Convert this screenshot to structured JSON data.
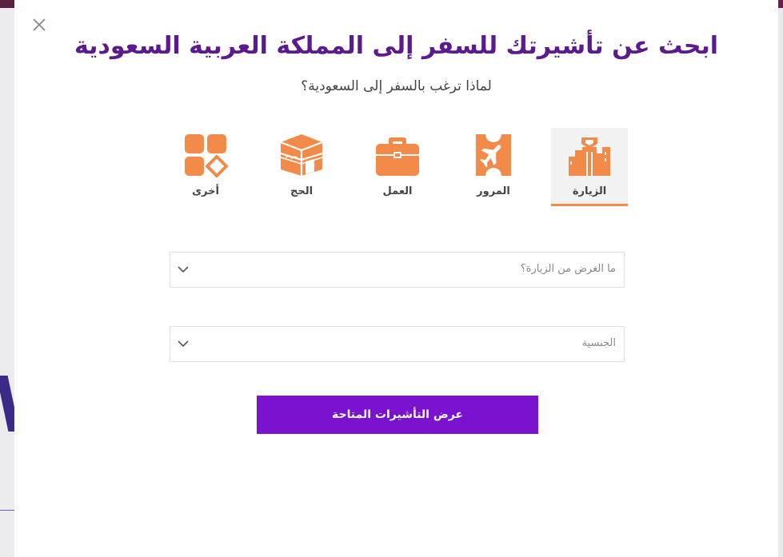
{
  "modal": {
    "title": "ابحث عن تأشيرتك للسفر إلى المملكة العربية السعودية",
    "subtitle": "لماذا ترغب بالسفر إلى السعودية؟"
  },
  "purposes": [
    {
      "label": "الزيارة",
      "icon": "buildings-icon",
      "selected": true
    },
    {
      "label": "المرور",
      "icon": "transit-ticket-plane-icon",
      "selected": false
    },
    {
      "label": "العمل",
      "icon": "briefcase-icon",
      "selected": false
    },
    {
      "label": "الحج",
      "icon": "kaaba-icon",
      "selected": false
    },
    {
      "label": "أخرى",
      "icon": "grid-other-icon",
      "selected": false
    }
  ],
  "form": {
    "visit_purpose_placeholder": "ما الغرض من الزيارة؟",
    "nationality_placeholder": "الجنسية",
    "submit_label": "عرض التأشيرات المتاحة"
  },
  "colors": {
    "title": "#5c1a8f",
    "icon": "#f28b4a",
    "button": "#7a12cf"
  }
}
